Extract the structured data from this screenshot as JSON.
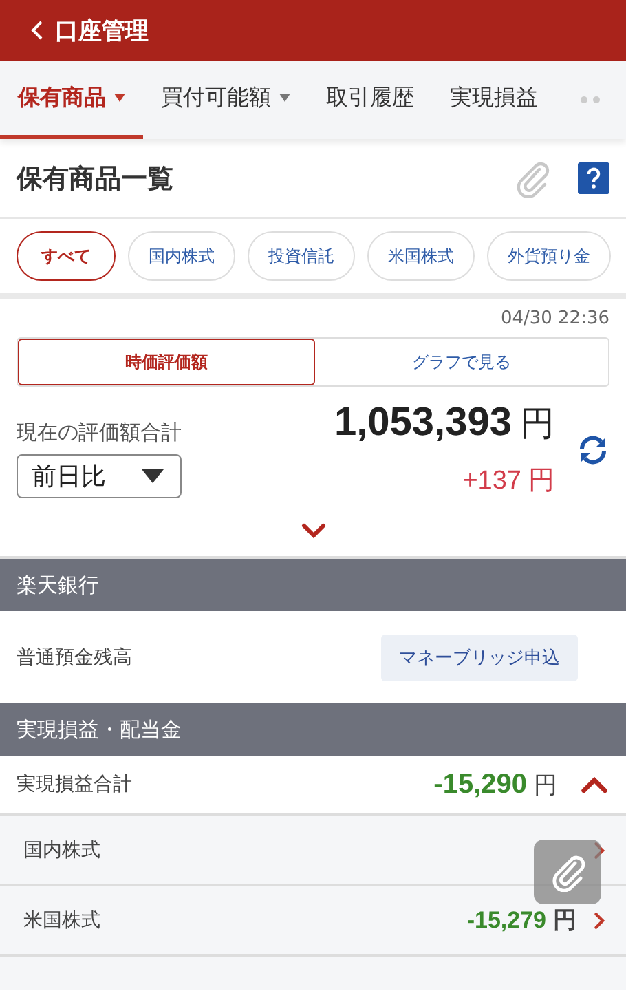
{
  "header": {
    "title": "口座管理"
  },
  "tabs": [
    {
      "label": "保有商品",
      "has_menu": true,
      "selected": true
    },
    {
      "label": "買付可能額",
      "has_menu": true,
      "selected": false
    },
    {
      "label": "取引履歴",
      "has_menu": false,
      "selected": false
    },
    {
      "label": "実現損益",
      "has_menu": false,
      "selected": false
    }
  ],
  "page_title": "保有商品一覧",
  "chips": [
    {
      "label": "すべて",
      "selected": true
    },
    {
      "label": "国内株式",
      "selected": false
    },
    {
      "label": "投資信託",
      "selected": false
    },
    {
      "label": "米国株式",
      "selected": false
    },
    {
      "label": "外貨預り金",
      "selected": false
    }
  ],
  "timestamp": "04/30 22:36",
  "view_toggle": [
    {
      "label": "時価評価額",
      "selected": true
    },
    {
      "label": "グラフで見る",
      "selected": false
    }
  ],
  "summary": {
    "label": "現在の評価額合計",
    "value": "1,053,393",
    "unit": "円",
    "compare": "前日比",
    "change": "+137",
    "change_unit": "円",
    "expanded": false
  },
  "bank": {
    "heading": "楽天銀行",
    "label": "普通預金残高",
    "button": "マネーブリッジ申込"
  },
  "realized": {
    "heading": "実現損益・配当金",
    "total_label": "実現損益合計",
    "total_value": "-15,290",
    "total_unit": "円",
    "expanded": true,
    "rows": [
      {
        "label": "国内株式"
      },
      {
        "label": "米国株式",
        "value": "-15,279",
        "unit": "円"
      }
    ]
  }
}
